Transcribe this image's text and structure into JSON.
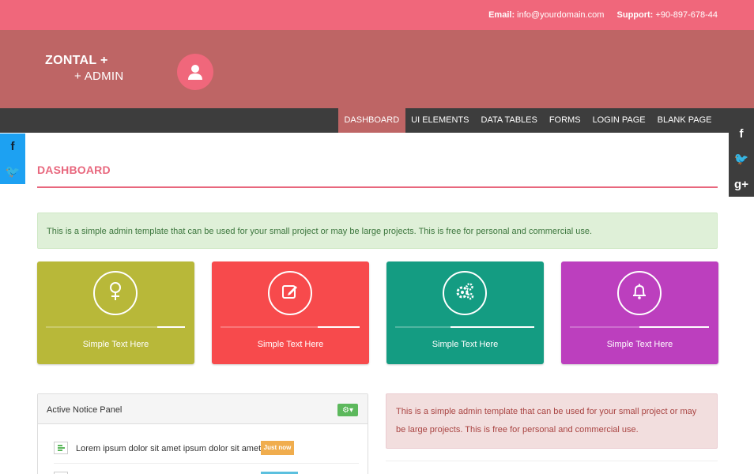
{
  "topbar": {
    "email_label": "Email:",
    "email_value": "info@yourdomain.com",
    "support_label": "Support:",
    "support_value": "+90-897-678-44"
  },
  "header": {
    "logo_line1": "ZONTAL +",
    "logo_line2": "+ ADMIN",
    "avatar_icon": "user-icon"
  },
  "nav": {
    "items": [
      {
        "label": "DASHBOARD",
        "active": true
      },
      {
        "label": "UI ELEMENTS",
        "active": false
      },
      {
        "label": "DATA TABLES",
        "active": false
      },
      {
        "label": "FORMS",
        "active": false
      },
      {
        "label": "LOGIN PAGE",
        "active": false
      },
      {
        "label": "BLANK PAGE",
        "active": false
      }
    ]
  },
  "social_left": [
    {
      "icon": "facebook-icon",
      "glyph": "f"
    },
    {
      "icon": "twitter-icon",
      "glyph": "🐦"
    }
  ],
  "social_right": [
    {
      "icon": "facebook-icon",
      "glyph": "f"
    },
    {
      "icon": "twitter-icon",
      "glyph": "🐦"
    },
    {
      "icon": "google-plus-icon",
      "glyph": "g+"
    }
  ],
  "page": {
    "title": "DASHBOARD",
    "success_alert": "This is a simple admin template that can be used for your small project or may be large projects. This is free for personal and commercial use."
  },
  "cards": [
    {
      "label": "Simple Text Here",
      "icon": "female-icon",
      "color": "#b8b839",
      "progress": 0.2
    },
    {
      "label": "Simple Text Here",
      "icon": "edit-icon",
      "color": "#f74a4c",
      "progress": 0.3
    },
    {
      "label": "Simple Text Here",
      "icon": "gears-icon",
      "color": "#149c82",
      "progress": 0.6
    },
    {
      "label": "Simple Text Here",
      "icon": "bell-icon",
      "color": "#bc3fbe",
      "progress": 0.5
    }
  ],
  "notice_panel": {
    "title": "Active Notice Panel",
    "settings_icon": "gear-icon",
    "items": [
      {
        "text": "Lorem ipsum dolor sit amet ipsum dolor sit amet",
        "badge": "Just now",
        "icon": "list-icon"
      }
    ]
  },
  "danger_alert": "This is a simple admin template that can be used for your small project or may be large projects. This is free for personal and commercial use.",
  "colors": {
    "accent": "#f0677b",
    "header": "#be6565",
    "navbar": "#3d3d3d",
    "title": "#e8677d"
  }
}
